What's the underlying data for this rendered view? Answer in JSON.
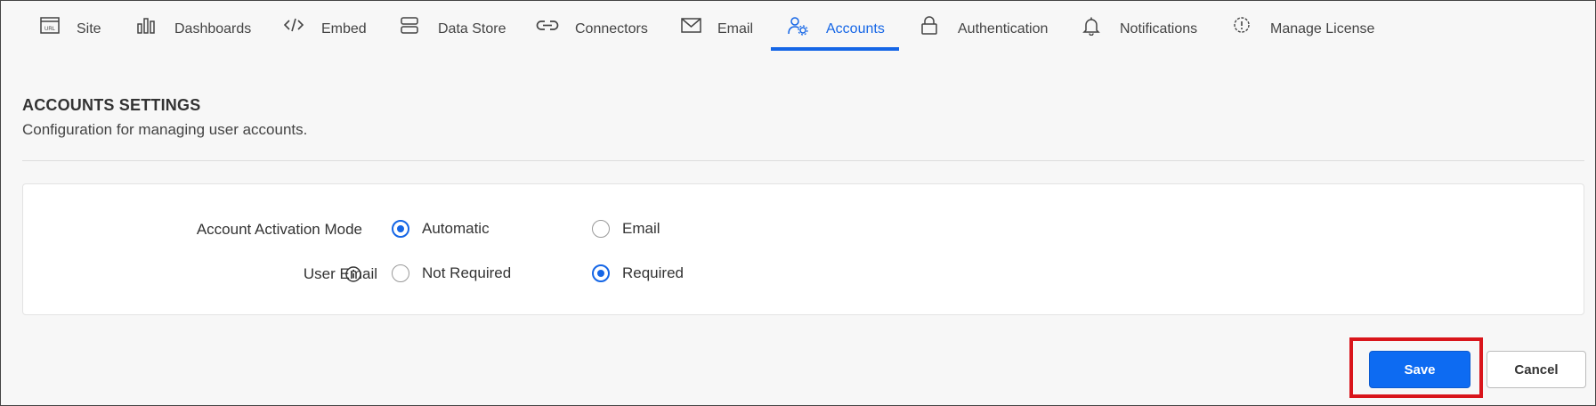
{
  "tabs": [
    {
      "label": "Site",
      "icon": "url-icon"
    },
    {
      "label": "Dashboards",
      "icon": "bar-chart-icon"
    },
    {
      "label": "Embed",
      "icon": "code-icon"
    },
    {
      "label": "Data Store",
      "icon": "database-icon"
    },
    {
      "label": "Connectors",
      "icon": "link-icon"
    },
    {
      "label": "Email",
      "icon": "envelope-icon"
    },
    {
      "label": "Accounts",
      "icon": "user-gear-icon"
    },
    {
      "label": "Authentication",
      "icon": "lock-icon"
    },
    {
      "label": "Notifications",
      "icon": "bell-icon"
    },
    {
      "label": "Manage License",
      "icon": "license-badge-icon"
    }
  ],
  "active_tab": "Accounts",
  "header": {
    "title": "ACCOUNTS SETTINGS",
    "subtitle": "Configuration for managing user accounts."
  },
  "settings": {
    "activation_mode": {
      "label": "Account Activation Mode",
      "options": [
        "Automatic",
        "Email"
      ],
      "selected": "Automatic"
    },
    "user_email": {
      "label": "User Email",
      "info_icon": "info-icon",
      "options": [
        "Not Required",
        "Required"
      ],
      "selected": "Required"
    }
  },
  "actions": {
    "save_label": "Save",
    "cancel_label": "Cancel"
  },
  "colors": {
    "accent": "#1566e6",
    "save_button": "#0d6bf2",
    "highlight_box": "#d9151b"
  }
}
